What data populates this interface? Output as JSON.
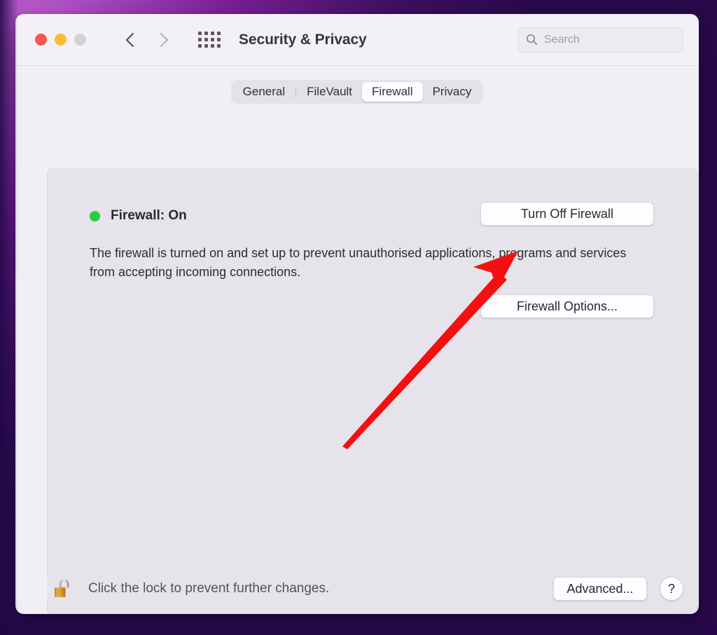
{
  "window": {
    "title": "Security & Privacy",
    "traffic_lights": [
      {
        "name": "close",
        "color": "#f9564f"
      },
      {
        "name": "minimize",
        "color": "#fcbc2d"
      },
      {
        "name": "zoom",
        "color": "#d4d1d6"
      }
    ],
    "nav": {
      "back_icon": "chevron-left-icon",
      "forward_icon": "chevron-right-icon"
    },
    "show_all_icon": "grid-icon",
    "search": {
      "icon": "search-icon",
      "placeholder": "Search",
      "value": ""
    }
  },
  "tabs": [
    {
      "label": "General",
      "selected": false
    },
    {
      "label": "FileVault",
      "selected": false
    },
    {
      "label": "Firewall",
      "selected": true
    },
    {
      "label": "Privacy",
      "selected": false
    }
  ],
  "firewall": {
    "status_label": "Firewall: On",
    "status_color": "#27cd41",
    "turn_off_label": "Turn Off Firewall",
    "description": "The firewall is turned on and set up to prevent unauthorised applications, programs and services from accepting incoming connections.",
    "options_label": "Firewall Options..."
  },
  "bottom": {
    "lock_icon": "unlocked-padlock-icon",
    "lock_note": "Click the lock to prevent further changes.",
    "advanced_label": "Advanced...",
    "help_label": "?"
  },
  "annotation": {
    "arrow_color": "#f41010",
    "points_at": "Firewall Options..."
  }
}
